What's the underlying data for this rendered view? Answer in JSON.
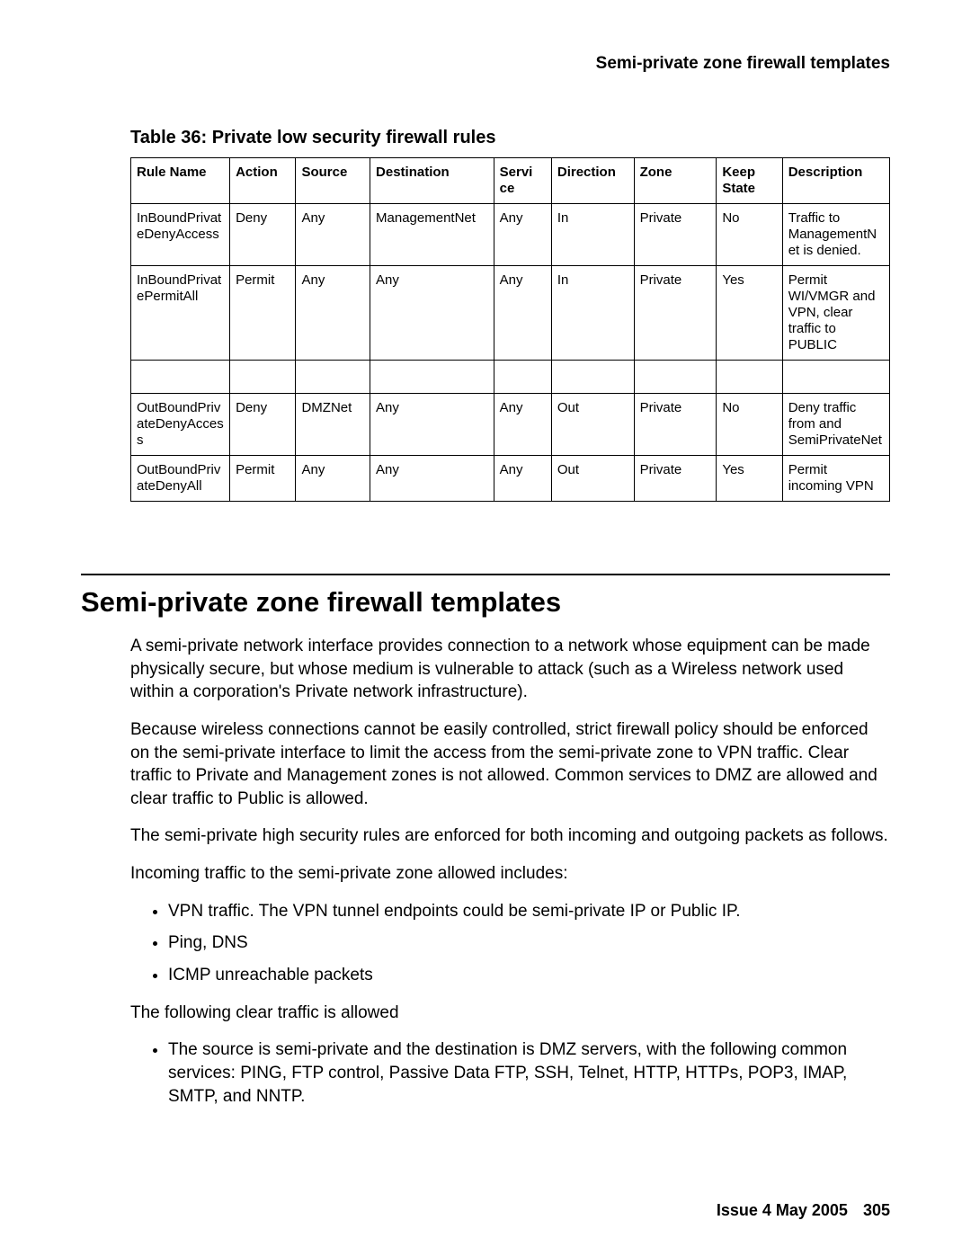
{
  "running_head": "Semi-private zone firewall templates",
  "table_caption": "Table 36: Private low security firewall rules",
  "columns": [
    "Rule Name",
    "Action",
    "Source",
    "Destination",
    "Service",
    "Direction",
    "Zone",
    "Keep State",
    "Description"
  ],
  "col_labels": {
    "rule": "Rule Name",
    "action": "Action",
    "source": "Source",
    "dest": "Destination",
    "svc": "Servi\nce",
    "dir": "Direction",
    "zone": "Zone",
    "keep": "Keep State",
    "desc": "Description"
  },
  "rows": [
    {
      "rule": "InBoundPrivateDenyAccess",
      "action": "Deny",
      "source": "Any",
      "dest": "ManagementNet",
      "svc": "Any",
      "dir": "In",
      "zone": "Private",
      "keep": "No",
      "desc": "Traffic to ManagementNet is denied."
    },
    {
      "rule": "InBoundPrivatePermitAll",
      "action": "Permit",
      "source": "Any",
      "dest": "Any",
      "svc": "Any",
      "dir": "In",
      "zone": "Private",
      "keep": "Yes",
      "desc": "Permit WI/VMGR and VPN, clear traffic to PUBLIC"
    },
    {
      "_empty": true
    },
    {
      "rule": "OutBoundPrivateDenyAccess",
      "action": "Deny",
      "source": "DMZNet",
      "dest": "Any",
      "svc": "Any",
      "dir": "Out",
      "zone": "Private",
      "keep": "No",
      "desc": "Deny traffic from and SemiPrivateNet"
    },
    {
      "rule": "OutBoundPrivateDenyAll",
      "action": "Permit",
      "source": "Any",
      "dest": "Any",
      "svc": "Any",
      "dir": "Out",
      "zone": "Private",
      "keep": "Yes",
      "desc": "Permit incoming VPN"
    }
  ],
  "section_title": "Semi-private zone firewall templates",
  "paragraphs": {
    "p1": "A semi-private network interface provides connection to a network whose equipment can be made physically secure, but whose medium is vulnerable to attack (such as a Wireless network used within a corporation's Private network infrastructure).",
    "p2": "Because wireless connections cannot be easily controlled, strict firewall policy should be enforced on the semi-private interface to limit the access from the semi-private zone to VPN traffic. Clear traffic to Private and Management zones is not allowed. Common services to DMZ are allowed and clear traffic to Public is allowed.",
    "p3": "The semi-private high security rules are enforced for both incoming and outgoing packets as follows.",
    "p4": "Incoming traffic to the semi-private zone allowed includes:",
    "p5": "The following clear traffic is allowed"
  },
  "bullets1": [
    "VPN traffic. The VPN tunnel endpoints could be semi-private IP or Public IP.",
    "Ping, DNS",
    "ICMP unreachable packets"
  ],
  "bullets2": [
    "The source is semi-private and the destination is DMZ servers, with the following common services: PING, FTP control, Passive Data FTP, SSH, Telnet, HTTP, HTTPs, POP3, IMAP, SMTP, and NNTP."
  ],
  "footer": {
    "issue": "Issue 4   May 2005",
    "page": "305"
  }
}
